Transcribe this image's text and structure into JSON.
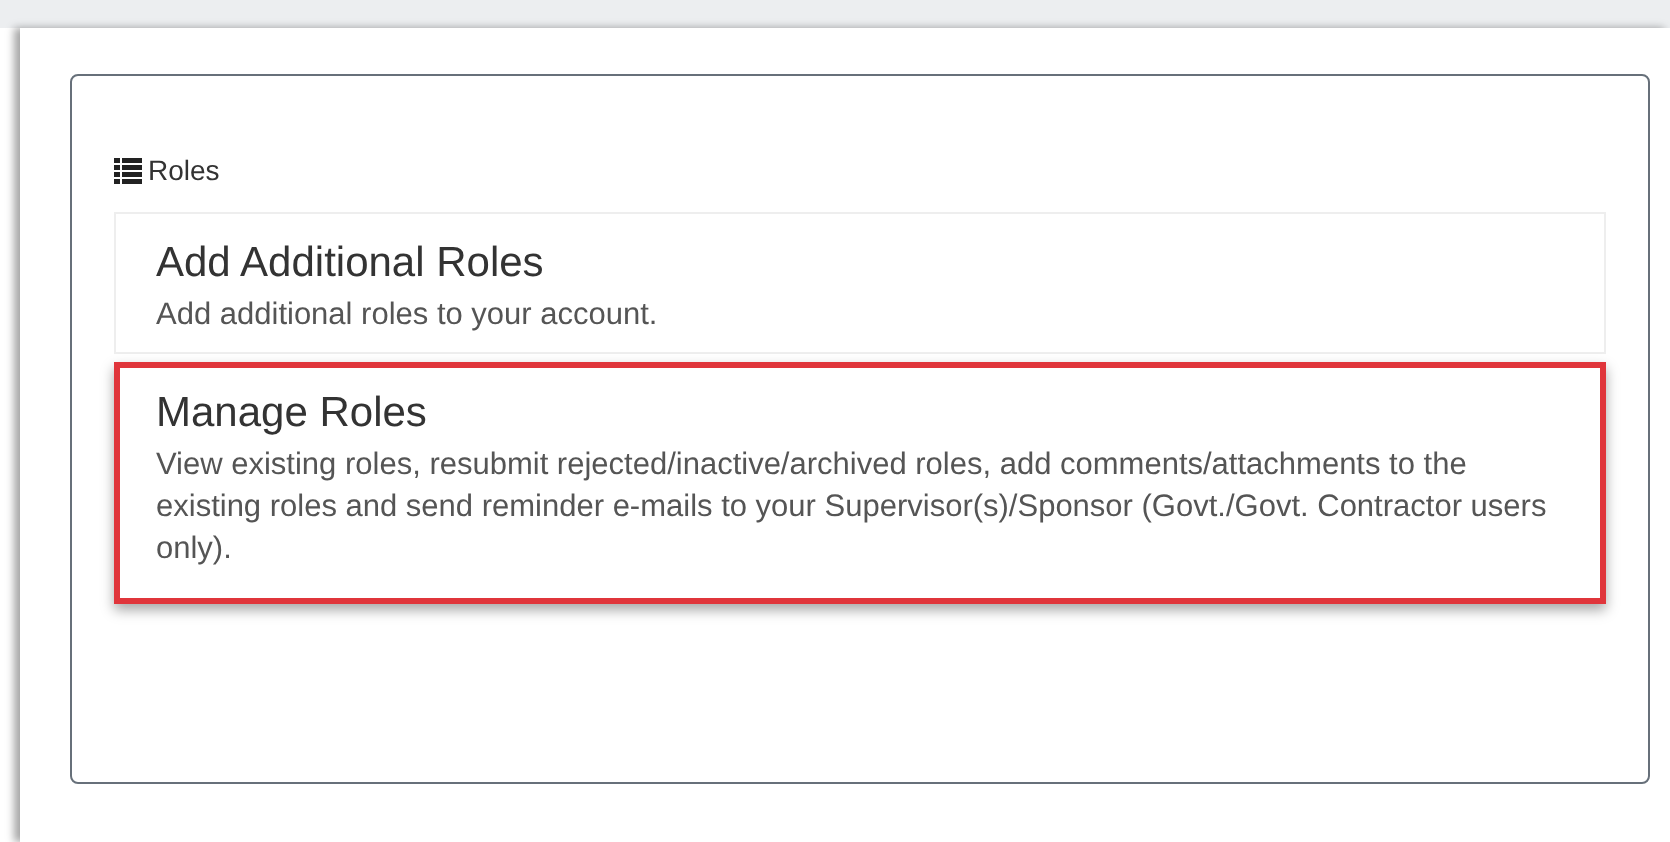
{
  "panel": {
    "title": "Roles"
  },
  "items": [
    {
      "title": "Add Additional Roles",
      "description": "Add additional roles to your account.",
      "highlighted": false
    },
    {
      "title": "Manage Roles",
      "description": "View existing roles, resubmit rejected/inactive/archived roles, add comments/attachments to the existing roles and send reminder e-mails to your Supervisor(s)/Sponsor (Govt./Govt. Contractor users only).",
      "highlighted": true
    }
  ]
}
